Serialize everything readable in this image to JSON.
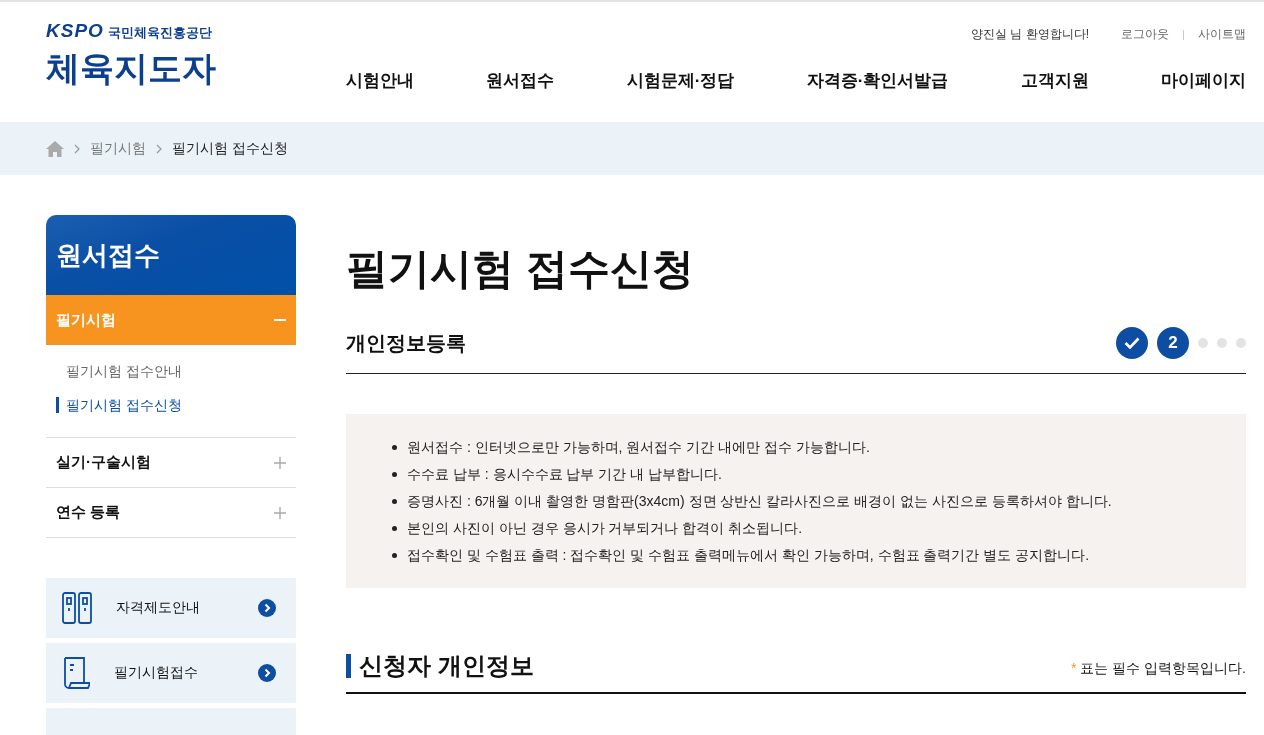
{
  "header": {
    "org": "국민체육진흥공단",
    "logo_mark": "KSPO",
    "site_title": "체육지도자",
    "user_greeting": "양진실 님 환영합니다!",
    "util_links": [
      "로그아웃",
      "사이트맵"
    ],
    "nav": [
      {
        "label": "시험안내"
      },
      {
        "label": "원서접수"
      },
      {
        "label": "시험문제·정답"
      },
      {
        "label": "자격증·확인서발급"
      },
      {
        "label": "고객지원"
      },
      {
        "label": "마이페이지"
      }
    ]
  },
  "breadcrumb": [
    "필기시험",
    "필기시험 접수신청"
  ],
  "sidebar": {
    "title": "원서접수",
    "items": [
      {
        "label": "필기시험",
        "expanded": true,
        "children": [
          {
            "label": "필기시험 접수안내",
            "selected": false
          },
          {
            "label": "필기시험 접수신청",
            "selected": true
          }
        ]
      },
      {
        "label": "실기·구술시험",
        "expanded": false
      },
      {
        "label": "연수 등록",
        "expanded": false
      }
    ],
    "quick_links": [
      {
        "kind": "cards",
        "label": "자격제도안내"
      },
      {
        "kind": "document",
        "label": "필기시험접수"
      }
    ]
  },
  "page_title": "필기시험 접수신청",
  "section": {
    "title": "개인정보등록",
    "steps": [
      {
        "kind": "done"
      },
      {
        "kind": "current",
        "label": "2"
      },
      {
        "kind": "pending"
      },
      {
        "kind": "pending"
      },
      {
        "kind": "pending"
      }
    ]
  },
  "notices": [
    "원서접수 : 인터넷으로만 가능하며, 원서접수 기간 내에만 접수 가능합니다.",
    "수수료 납부 : 응시수수료 납부 기간 내 납부합니다.",
    "증명사진 : 6개월 이내 촬영한 명함판(3x4cm) 정면 상반신 칼라사진으로 배경이 없는 사진으로 등록하셔야 합니다.",
    "본인의 사진이 아닌 경우 응시가 거부되거나 합격이 취소됩니다.",
    "접수확인 및 수험표 출력 : 접수확인 및 수험표 출력메뉴에서 확인 가능하며, 수험표 출력기간 별도 공지합니다."
  ],
  "applicant": {
    "title": "신청자 개인정보",
    "required_mark": "*",
    "required_note": "표는 필수 입력항목입니다."
  }
}
